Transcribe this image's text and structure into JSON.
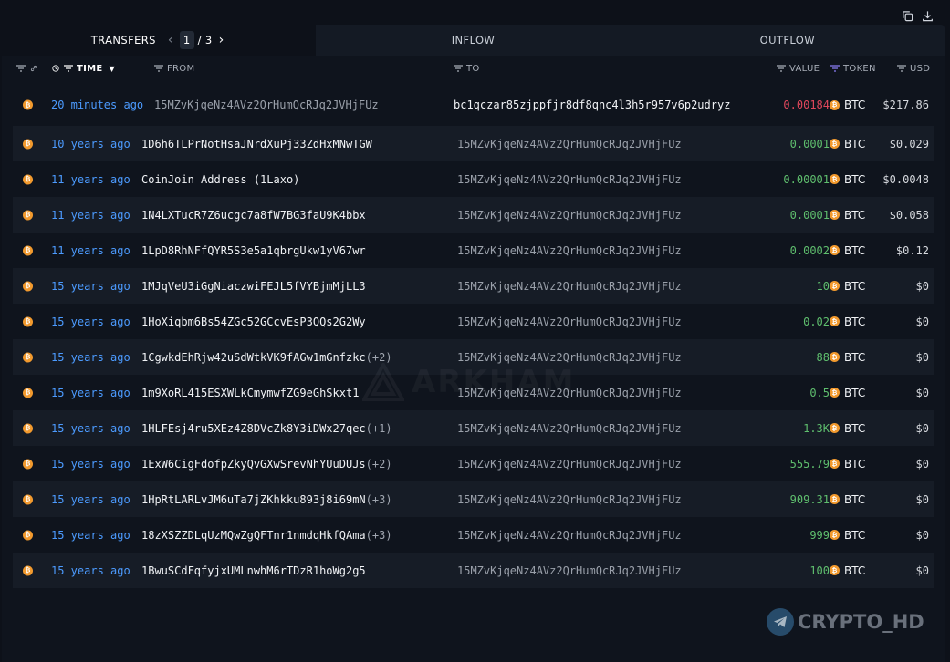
{
  "tabs": {
    "transfers": "TRANSFERS",
    "page_current": "1",
    "page_sep": "/",
    "page_total": "3",
    "inflow": "INFLOW",
    "outflow": "OUTFLOW"
  },
  "columns": {
    "time": "TIME",
    "from": "FROM",
    "to": "TO",
    "value": "VALUE",
    "token": "TOKEN",
    "usd": "USD"
  },
  "rows": [
    {
      "time": "20 minutes ago",
      "from": "15MZvKjqeNz4AVz2QrHumQcRJq2JVHjFUz",
      "from_extra": "",
      "to": "bc1qczar85zjppfjr8df8qnc4l3h5r957v6p2udryz",
      "value": "0.00184",
      "token": "BTC",
      "usd": "$217.86"
    },
    {
      "time": "10 years ago",
      "from": "1D6h6TLPrNotHsaJNrdXuPj33ZdHxMNwTGW",
      "from_extra": "",
      "to": "15MZvKjqeNz4AVz2QrHumQcRJq2JVHjFUz",
      "value": "0.0001",
      "token": "BTC",
      "usd": "$0.029"
    },
    {
      "time": "11 years ago",
      "from": "CoinJoin Address (1Laxo)",
      "from_extra": "",
      "to": "15MZvKjqeNz4AVz2QrHumQcRJq2JVHjFUz",
      "value": "0.00001",
      "token": "BTC",
      "usd": "$0.0048"
    },
    {
      "time": "11 years ago",
      "from": "1N4LXTucR7Z6ucgc7a8fW7BG3faU9K4bbx",
      "from_extra": "",
      "to": "15MZvKjqeNz4AVz2QrHumQcRJq2JVHjFUz",
      "value": "0.0001",
      "token": "BTC",
      "usd": "$0.058"
    },
    {
      "time": "11 years ago",
      "from": "1LpD8RhNFfQYR5S3e5a1qbrgUkw1yV67wr",
      "from_extra": "",
      "to": "15MZvKjqeNz4AVz2QrHumQcRJq2JVHjFUz",
      "value": "0.0002",
      "token": "BTC",
      "usd": "$0.12"
    },
    {
      "time": "15 years ago",
      "from": "1MJqVeU3iGgNiaczwiFEJL5fVYBjmMjLL3",
      "from_extra": "",
      "to": "15MZvKjqeNz4AVz2QrHumQcRJq2JVHjFUz",
      "value": "10",
      "token": "BTC",
      "usd": "$0"
    },
    {
      "time": "15 years ago",
      "from": "1HoXiqbm6Bs54ZGc52GCcvEsP3QQs2G2Wy",
      "from_extra": "",
      "to": "15MZvKjqeNz4AVz2QrHumQcRJq2JVHjFUz",
      "value": "0.02",
      "token": "BTC",
      "usd": "$0"
    },
    {
      "time": "15 years ago",
      "from": "1CgwkdEhRjw42uSdWtkVK9fAGw1mGnfzkc",
      "from_extra": "(+2)",
      "to": "15MZvKjqeNz4AVz2QrHumQcRJq2JVHjFUz",
      "value": "88",
      "token": "BTC",
      "usd": "$0"
    },
    {
      "time": "15 years ago",
      "from": "1m9XoRL415ESXWLkCmymwfZG9eGhSkxt1",
      "from_extra": "",
      "to": "15MZvKjqeNz4AVz2QrHumQcRJq2JVHjFUz",
      "value": "0.5",
      "token": "BTC",
      "usd": "$0"
    },
    {
      "time": "15 years ago",
      "from": "1HLFEsj4ru5XEz4Z8DVcZk8Y3iDWx27qec",
      "from_extra": "(+1)",
      "to": "15MZvKjqeNz4AVz2QrHumQcRJq2JVHjFUz",
      "value": "1.3K",
      "token": "BTC",
      "usd": "$0"
    },
    {
      "time": "15 years ago",
      "from": "1ExW6CigFdofpZkyQvGXwSrevNhYUuDUJs",
      "from_extra": "(+2)",
      "to": "15MZvKjqeNz4AVz2QrHumQcRJq2JVHjFUz",
      "value": "555.79",
      "token": "BTC",
      "usd": "$0"
    },
    {
      "time": "15 years ago",
      "from": "1HpRtLARLvJM6uTa7jZKhkku893j8i69mN",
      "from_extra": "(+3)",
      "to": "15MZvKjqeNz4AVz2QrHumQcRJq2JVHjFUz",
      "value": "909.31",
      "token": "BTC",
      "usd": "$0"
    },
    {
      "time": "15 years ago",
      "from": "18zXSZZDLqUzMQwZgQFTnr1nmdqHkfQAma",
      "from_extra": "(+3)",
      "to": "15MZvKjqeNz4AVz2QrHumQcRJq2JVHjFUz",
      "value": "999",
      "token": "BTC",
      "usd": "$0"
    },
    {
      "time": "15 years ago",
      "from": "1BwuSCdFqfyjxUMLnwhM6rTDzR1hoWg2g5",
      "from_extra": "",
      "to": "15MZvKjqeNz4AVz2QrHumQcRJq2JVHjFUz",
      "value": "100",
      "token": "BTC",
      "usd": "$0"
    }
  ],
  "colors": {
    "accent_time": "#4c9bff",
    "value_out": "#e0475b",
    "value_in": "#5fbf6e",
    "btc": "#f29a2e"
  },
  "watermarks": {
    "center": "ARKHAM",
    "corner": "CRYPTO_HD"
  }
}
